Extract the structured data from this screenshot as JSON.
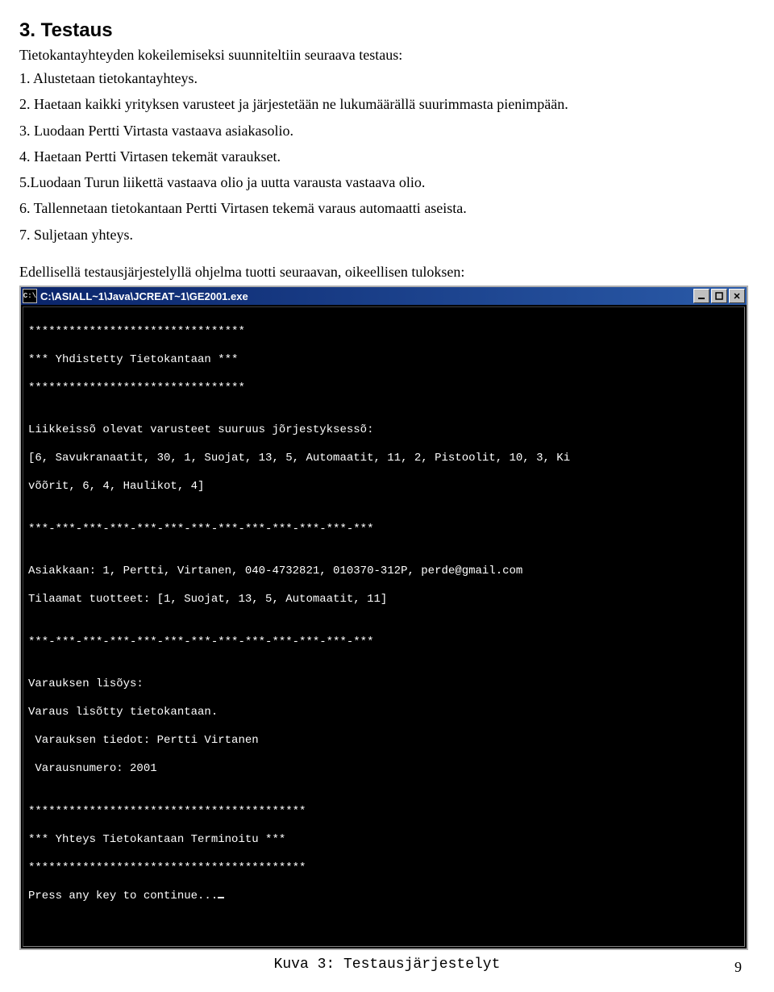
{
  "section": {
    "heading": "3. Testaus",
    "intro": "Tietokantayhteyden kokeilemiseksi suunniteltiin seuraava testaus:",
    "steps": [
      "1. Alustetaan tietokantayhteys.",
      "2. Haetaan kaikki yrityksen varusteet ja järjestetään ne lukumäärällä suurimmasta pienimpään.",
      "3. Luodaan Pertti Virtasta vastaava asiakasolio.",
      "4. Haetaan Pertti Virtasen tekemät varaukset.",
      "5.Luodaan Turun liikettä vastaava olio ja uutta varausta vastaava olio.",
      "6. Tallennetaan tietokantaan Pertti Virtasen tekemä varaus automaatti aseista.",
      "7. Suljetaan yhteys."
    ],
    "result_intro": "Edellisellä testausjärjestelyllä ohjelma tuotti seuraavan, oikeellisen tuloksen:"
  },
  "console": {
    "title": "C:\\ASIALL~1\\Java\\JCREAT~1\\GE2001.exe",
    "buttons": {
      "min": "—",
      "max": "▢",
      "close": "✕"
    },
    "lines": [
      "********************************",
      "*** Yhdistetty Tietokantaan ***",
      "********************************",
      "",
      "Liikkeissõ olevat varusteet suuruus jõrjestyksessõ:",
      "[6, Savukranaatit, 30, 1, Suojat, 13, 5, Automaatit, 11, 2, Pistoolit, 10, 3, Ki",
      "võõrit, 6, 4, Haulikot, 4]",
      "",
      "***-***-***-***-***-***-***-***-***-***-***-***-***",
      "",
      "Asiakkaan: 1, Pertti, Virtanen, 040-4732821, 010370-312P, perde@gmail.com",
      "Tilaamat tuotteet: [1, Suojat, 13, 5, Automaatit, 11]",
      "",
      "***-***-***-***-***-***-***-***-***-***-***-***-***",
      "",
      "Varauksen lisõys:",
      "Varaus lisõtty tietokantaan.",
      " Varauksen tiedot: Pertti Virtanen",
      " Varausnumero: 2001",
      "",
      "*****************************************",
      "*** Yhteys Tietokantaan Terminoitu ***",
      "*****************************************",
      "Press any key to continue..."
    ]
  },
  "caption": "Kuva 3: Testausjärjestelyt",
  "page_number": "9"
}
